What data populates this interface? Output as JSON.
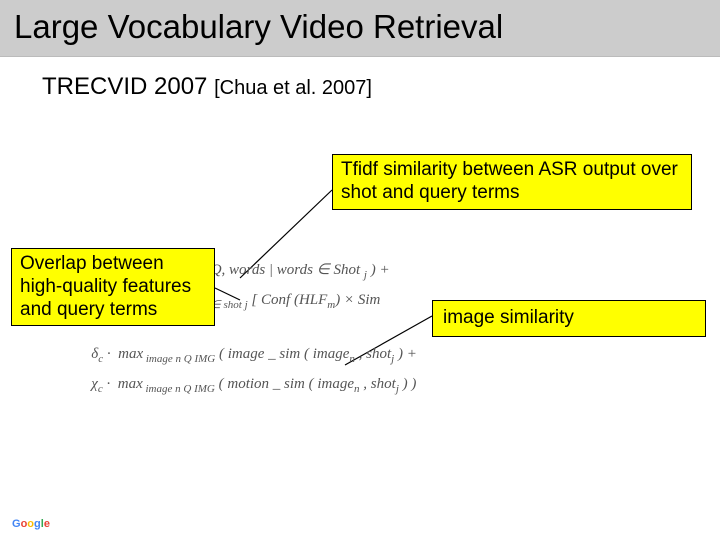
{
  "slide": {
    "title": "Large Vocabulary Video Retrieval",
    "subtitle": "TRECVID 2007 ",
    "citation": "[Chua et al. 2007]"
  },
  "callouts": {
    "top_right": "Tfidf similarity between ASR output over shot and query terms",
    "left": "Overlap between high-quality features and query terms",
    "right": "image similarity"
  },
  "formula": {
    "line1": "Text (Q, words | words ∈ Shot j ) +",
    "line2_prefix": "∑ HLF m ∈ shot j",
    "line2_body": "[ Conf (HLF m ) × Sim",
    "line3": "δ c · max image n Q IMG ( image _ sim ( image n , shot j ) +",
    "line4": "χ c · max image n Q IMG ( motion _ sim ( image n , shot j ) )"
  },
  "branding": {
    "company": "Google"
  }
}
